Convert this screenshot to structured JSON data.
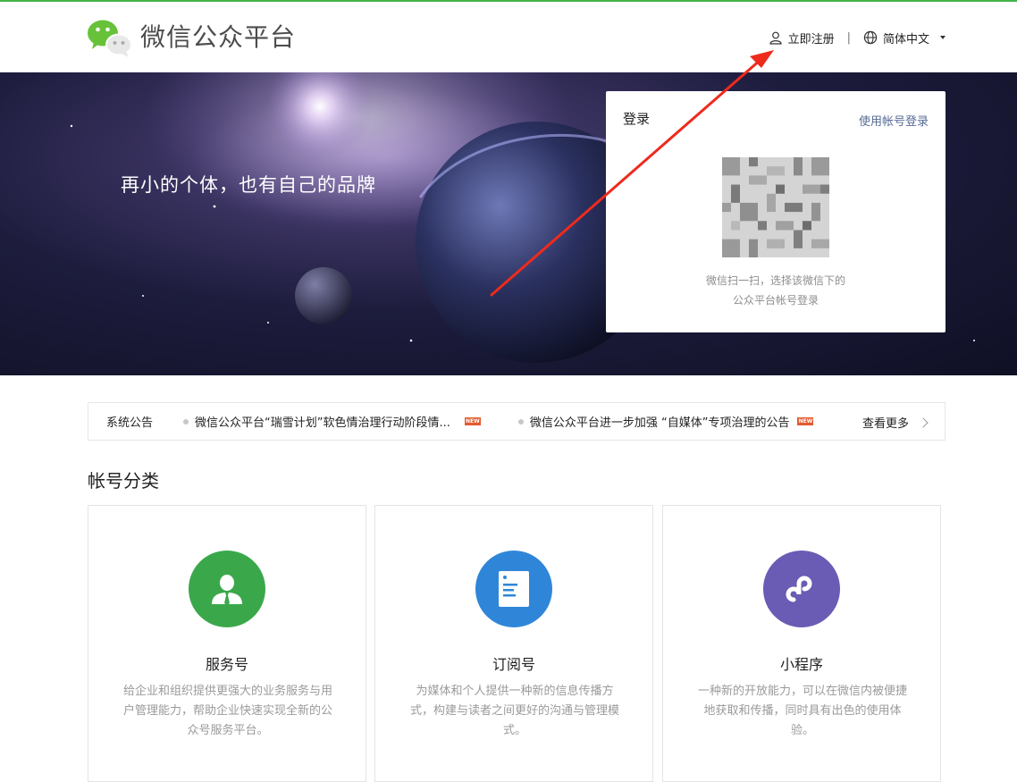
{
  "header": {
    "brand": "微信公众平台",
    "register_label": "立即注册",
    "separator": "|",
    "language_label": "简体中文"
  },
  "banner": {
    "slogan": "再小的个体，也有自己的品牌"
  },
  "login": {
    "title": "登录",
    "alt_login_label": "使用帐号登录",
    "qr_tip_line1": "微信扫一扫，选择该微信下的",
    "qr_tip_line2": "公众平台帐号登录"
  },
  "notice": {
    "label": "系统公告",
    "items": [
      {
        "text": "微信公众平台“瑞雪计划”软色情治理行动阶段情...",
        "badge": "NEW"
      },
      {
        "text": "微信公众平台进一步加强 “自媒体”专项治理的公告",
        "badge": "NEW"
      }
    ],
    "more_label": "查看更多"
  },
  "categories": {
    "title": "帐号分类",
    "cards": [
      {
        "icon": "service-account-icon",
        "color": "#3aa84a",
        "title": "服务号",
        "desc": "给企业和组织提供更强大的业务服务与用户管理能力，帮助企业快速实现全新的公众号服务平台。"
      },
      {
        "icon": "subscription-account-icon",
        "color": "#2f86d8",
        "title": "订阅号",
        "desc": "为媒体和个人提供一种新的信息传播方式，构建与读者之间更好的沟通与管理模式。"
      },
      {
        "icon": "mini-program-icon",
        "color": "#6a5bb4",
        "title": "小程序",
        "desc": "一种新的开放能力，可以在微信内被便捷地获取和传播，同时具有出色的使用体验。"
      }
    ]
  },
  "colors": {
    "accent_green": "#44b549",
    "link_blue": "#576b95",
    "annotation_red": "#ee2a1c"
  }
}
